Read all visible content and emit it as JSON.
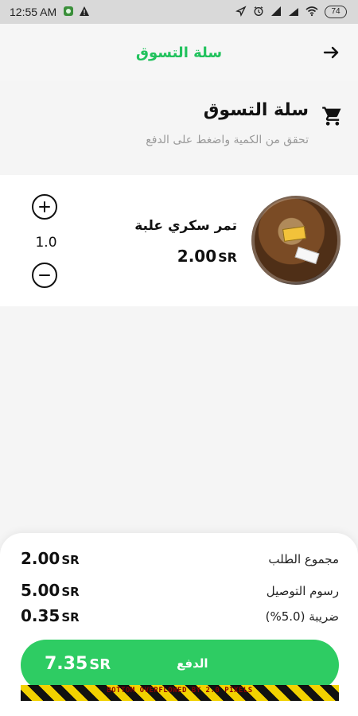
{
  "status_bar": {
    "time": "12:55 AM",
    "battery": "74",
    "icons": [
      "app-notification-icon",
      "warning-icon",
      "location-icon",
      "alarm-icon",
      "signal-icon",
      "signal-icon",
      "wifi-icon",
      "battery-icon"
    ]
  },
  "app_bar": {
    "title": "سلة التسوق",
    "back_icon": "arrow-right-icon"
  },
  "header": {
    "title": "سلة التسوق",
    "subtitle": "تحقق من الكمية واضغط على الدفع",
    "icon": "shopping-cart-icon"
  },
  "cart": {
    "items": [
      {
        "name": "تمر سكري علبة",
        "price": "2.00",
        "currency": "SR",
        "quantity": "1.0"
      }
    ]
  },
  "summary": {
    "rows": [
      {
        "label": "مجموع الطلب",
        "value": "2.00",
        "currency": "SR"
      },
      {
        "label": "رسوم التوصيل",
        "value": "5.00",
        "currency": "SR"
      },
      {
        "label": "ضريبة (5.0%)",
        "value": "0.35",
        "currency": "SR"
      }
    ],
    "pay_button": {
      "total": "7.35",
      "currency": "SR",
      "label": "الدفع"
    },
    "overflow_warning": "BOTTOM OVERFLOWED BY 2.0 PIXELS"
  },
  "colors": {
    "accent_green": "#2ecc63",
    "title_green": "#21c25d"
  }
}
